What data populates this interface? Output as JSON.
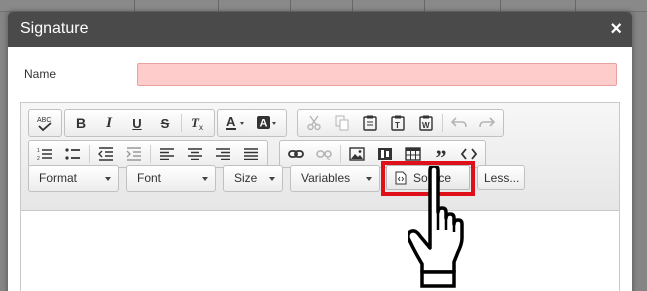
{
  "modal": {
    "title": "Signature",
    "close_glyph": "×"
  },
  "name_field": {
    "label": "Name",
    "value": ""
  },
  "toolbar": {
    "row1": [
      {
        "name": "spellcheck-icon",
        "glyph": "ABC✓"
      },
      {
        "name": "bold-button",
        "glyph": "B"
      },
      {
        "name": "italic-button",
        "glyph": "I"
      },
      {
        "name": "underline-button",
        "glyph": "U"
      },
      {
        "name": "strikethrough-button",
        "glyph": "S"
      },
      {
        "name": "remove-format-button",
        "glyph": "Tx"
      },
      {
        "name": "text-color-button",
        "glyph": "A"
      },
      {
        "name": "background-color-button",
        "glyph": "A"
      }
    ],
    "comboboxes": {
      "format": "Format",
      "font": "Font",
      "size": "Size",
      "variables": "Variables"
    },
    "source_label": "Source",
    "less_label": "Less..."
  },
  "colors": {
    "header_bg": "#4a4a4a",
    "name_input_bg": "#ffcccc",
    "highlight": "#e0101a"
  }
}
